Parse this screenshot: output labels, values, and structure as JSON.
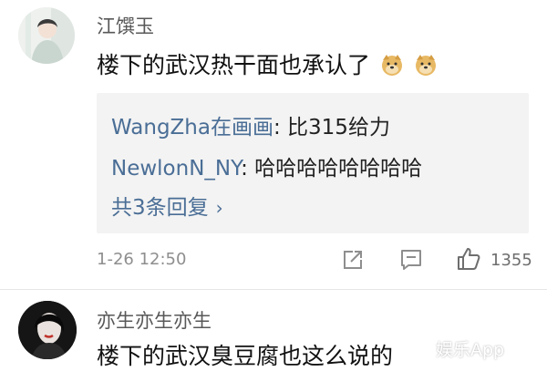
{
  "comments": [
    {
      "username": "江馔玉",
      "content": "楼下的武汉热干面也承认了",
      "emojis": [
        "doge-emoji",
        "doge-emoji"
      ],
      "replies": [
        {
          "name": "WangZha在画画",
          "text": ": 比315给力"
        },
        {
          "name": "NewlonN_NY",
          "text": ": 哈哈哈哈哈哈哈哈"
        }
      ],
      "more_replies": "共3条回复",
      "time": "1-26 12:50",
      "like_count": "1355"
    },
    {
      "username": "亦生亦生亦生",
      "content": "楼下的武汉臭豆腐也这么说的"
    }
  ],
  "watermark": "娱乐App",
  "colors": {
    "link": "#4a6e96",
    "username": "#585858",
    "meta": "#8e8e8e",
    "reply_bg": "#f3f3f3"
  }
}
